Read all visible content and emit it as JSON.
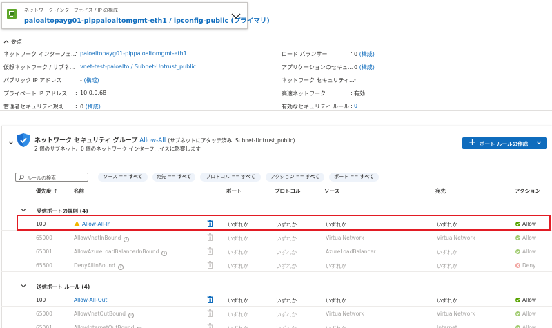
{
  "nic_selector": {
    "caption": "ネットワーク インターフェイス / IP の構成",
    "value": "paloaltopayg01-pippaloaltomgmt-eth1 / ipconfig-public (プライマリ)"
  },
  "essentials": {
    "header": "要点",
    "left": [
      {
        "label": "ネットワーク インターフェ...",
        "value": "paloaltopayg01-pippaloaltomgmt-eth1",
        "link": true
      },
      {
        "label": "仮想ネットワーク / サブネ...",
        "value": "vnet-test-paloalto / Subnet-Untrust_public",
        "link": true
      },
      {
        "label": "パブリック IP アドレス",
        "value": "- ",
        "extra": "(構成)"
      },
      {
        "label": "プライベート IP アドレス",
        "value": "10.0.0.68"
      },
      {
        "label": "管理者セキュリティ規則",
        "value": "0 ",
        "extra": "(構成)"
      }
    ],
    "right": [
      {
        "label": "ロード バランサー",
        "value": "0 ",
        "extra": "(構成)"
      },
      {
        "label": "アプリケーションのセキュ...",
        "value": "0 ",
        "extra": "(構成)"
      },
      {
        "label": "ネットワーク セキュリティ...",
        "value": "-"
      },
      {
        "label": "高速ネットワーク",
        "value": "有効"
      },
      {
        "label": "有効なセキュリティ ルール",
        "value": "",
        "extra": "0"
      }
    ]
  },
  "nsg": {
    "title_prefix": "ネットワーク セキュリティ グループ",
    "name": "Allow-All",
    "attached_prefix": "(サブネットにアタッチ済み: ",
    "subnet": "Subnet-Untrust_public",
    "attached_suffix": ")",
    "subtitle": "2 個のサブネット、0 個のネットワーク インターフェイスに影響します",
    "create_button": "ポート ルールの作成"
  },
  "filters": {
    "search_placeholder": "ルールの検索",
    "pills": [
      {
        "key": "ソース == ",
        "val": "すべて"
      },
      {
        "key": "宛先 == ",
        "val": "すべて"
      },
      {
        "key": "プロトコル == ",
        "val": "すべて"
      },
      {
        "key": "アクション == ",
        "val": "すべて"
      },
      {
        "key": "ポート == ",
        "val": "すべて"
      }
    ]
  },
  "table": {
    "headers": {
      "priority": "優先度",
      "priority_sort": "↑",
      "name": "名前",
      "port": "ポート",
      "protocol": "プロトコル",
      "source": "ソース",
      "destination": "宛先",
      "action": "アクション"
    },
    "groups": [
      {
        "label": "受信ポートの規則 (4)",
        "rows": [
          {
            "priority": "100",
            "name": "Allow-All-In",
            "port": "いずれか",
            "protocol": "いずれか",
            "source": "いずれか",
            "destination": "いずれか",
            "action": "Allow"
          },
          {
            "priority": "65000",
            "name": "AllowVnetInBound",
            "port": "いずれか",
            "protocol": "いずれか",
            "source": "VirtualNetwork",
            "destination": "VirtualNetwork",
            "action": "Allow"
          },
          {
            "priority": "65001",
            "name": "AllowAzureLoadBalancerInBound",
            "port": "いずれか",
            "protocol": "いずれか",
            "source": "AzureLoadBalancer",
            "destination": "いずれか",
            "action": "Allow"
          },
          {
            "priority": "65500",
            "name": "DenyAllInBound",
            "port": "いずれか",
            "protocol": "いずれか",
            "source": "いずれか",
            "destination": "いずれか",
            "action": "Deny"
          }
        ]
      },
      {
        "label": "送信ポート ルール (4)",
        "rows": [
          {
            "priority": "100",
            "name": "Allow-All-Out",
            "port": "いずれか",
            "protocol": "いずれか",
            "source": "いずれか",
            "destination": "いずれか",
            "action": "Allow"
          },
          {
            "priority": "65000",
            "name": "AllowVnetOutBound",
            "port": "いずれか",
            "protocol": "いずれか",
            "source": "VirtualNetwork",
            "destination": "VirtualNetwork",
            "action": "Allow"
          },
          {
            "priority": "65001",
            "name": "AllowInternetOutBound",
            "port": "いずれか",
            "protocol": "いずれか",
            "source": "いずれか",
            "destination": "Internet",
            "action": "Allow"
          }
        ]
      }
    ]
  },
  "colors": {
    "accent": "#0f6cbd",
    "allow": "#57a300",
    "deny": "#e5534b",
    "warning": "#f2b600",
    "highlight": "#e21c24"
  }
}
